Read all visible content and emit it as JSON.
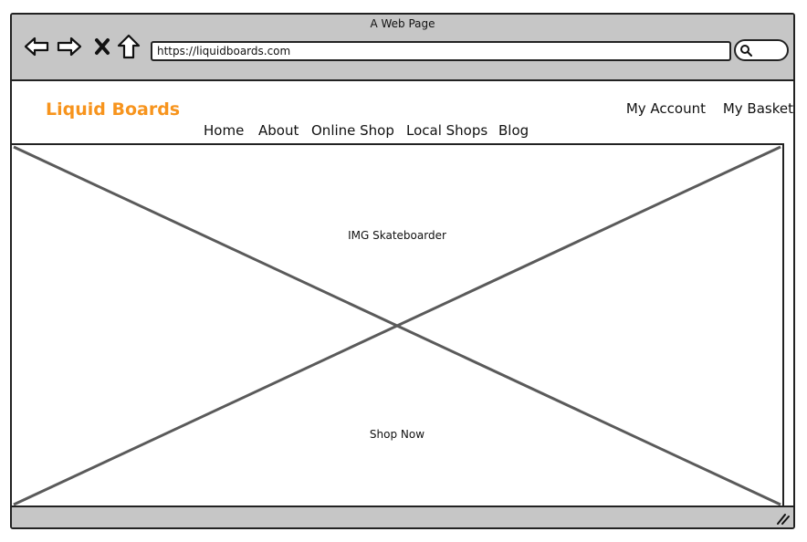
{
  "window": {
    "title": "A Web Page"
  },
  "toolbar": {
    "url": "https://liquidboards.com",
    "icons": [
      "back-arrow-icon",
      "forward-arrow-icon",
      "close-x-icon",
      "home-icon",
      "search-icon"
    ]
  },
  "brand": {
    "name": "Liquid Boards",
    "color": "#f7941d"
  },
  "account_links": [
    "My Account",
    "My Basket"
  ],
  "nav": [
    "Home",
    "About",
    "Online Shop",
    "Local Shops",
    "Blog"
  ],
  "hero": {
    "image_label": "IMG Skateboarder",
    "cta_label": "Shop Now"
  },
  "colors": {
    "chrome": "#c6c6c6",
    "border": "#222222",
    "placeholder_line": "#5a5a5a"
  }
}
